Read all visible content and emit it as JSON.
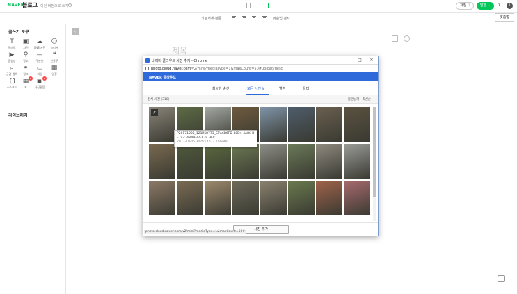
{
  "header": {
    "brand": "NAVER",
    "blog_name": "블로그",
    "old_version_link": "이전 버전으로 쓰기",
    "save_label": "저장",
    "save_count": "1",
    "publish_label": "발행",
    "help_label": "?",
    "more_label": "i"
  },
  "format_bar": {
    "font_family": "기본서체·본문",
    "spacing": "맞춤법 검사"
  },
  "spell_check_label": "맞춤법",
  "sidebar": {
    "writing_tools_title": "글쓰기 도구",
    "library_title": "라이브러리",
    "tools": [
      {
        "label": "텍스트",
        "icon": "text-icon",
        "glyph": "T"
      },
      {
        "label": "사진",
        "icon": "image-icon",
        "glyph": "▣"
      },
      {
        "label": "SNS 사진",
        "icon": "cloud-icon",
        "glyph": "☁"
      },
      {
        "label": "스티커",
        "icon": "sticker-icon",
        "glyph": "☺"
      },
      {
        "label": "동영상",
        "icon": "video-icon",
        "glyph": "▶"
      },
      {
        "label": "장소",
        "icon": "place-icon",
        "glyph": "⚲"
      },
      {
        "label": "구분선",
        "icon": "divider-icon",
        "glyph": "—"
      },
      {
        "label": "인용구",
        "icon": "quote-icon",
        "glyph": "❝"
      },
      {
        "label": "글감 검색",
        "icon": "search-icon",
        "glyph": "⌕"
      },
      {
        "label": "링크",
        "icon": "link-icon",
        "glyph": "⚭"
      },
      {
        "label": "파일",
        "icon": "file-icon",
        "glyph": "▭"
      },
      {
        "label": "일정",
        "icon": "calendar-icon",
        "glyph": "▦"
      },
      {
        "label": "소스코드",
        "icon": "code-icon",
        "glyph": "{}"
      },
      {
        "label": "표",
        "icon": "table-icon",
        "glyph": "▦",
        "badge": "N"
      },
      {
        "label": "사진편집",
        "icon": "photo-edit-icon",
        "glyph": "▣",
        "badge": "N"
      }
    ]
  },
  "editor": {
    "title_placeholder": "제목"
  },
  "popup": {
    "window_title": "네이버 클라우드 사진 추가 - Chrome",
    "url_host": "photo.cloud.naver.com",
    "url_path": "/v2/mini?mediaType=1&maxCount=50#upload/desc",
    "service_name": "NAVER 클라우드",
    "tabs": [
      {
        "label": "최볼한 순간",
        "active": false
      },
      {
        "label": "모든 사진",
        "count": "N",
        "active": true
      },
      {
        "label": "앨범",
        "active": false
      },
      {
        "label": "폴더",
        "active": false
      }
    ],
    "photo_count": "전체 사진 (318)",
    "sort_label": "촬영날짜 · 최신순",
    "tooltip": {
      "filename_line1": "P20171005_121958773_C7A6B6FD-38D4-4A86-B",
      "filename_line2": "E74-C2680F22F779.HEIC",
      "meta": "2017-10-05      3024×4032      1.99MB"
    },
    "add_button_label": "사진 추가",
    "status_url": "photo.cloud.naver.com/v2/mini?mediaType=1&maxCount=50#",
    "tile_colors": [
      "#8a8478",
      "#5d6b45",
      "#a3a8a2",
      "#6e5a3e",
      "#7f94a8",
      "#4e5d6b",
      "#6a6050",
      "#5b5240",
      "#7a6a50",
      "#4f5a3c",
      "#5a6a3e",
      "#6c7a52",
      "#8e8f88",
      "#6b7a58",
      "#8f8a80",
      "#9a9c98",
      "#8d7a66",
      "#7b6c54",
      "#9e8a6e",
      "#6e6a5a",
      "#8b8270",
      "#6a7a4e",
      "#a0634a",
      "#a86a6e"
    ]
  }
}
